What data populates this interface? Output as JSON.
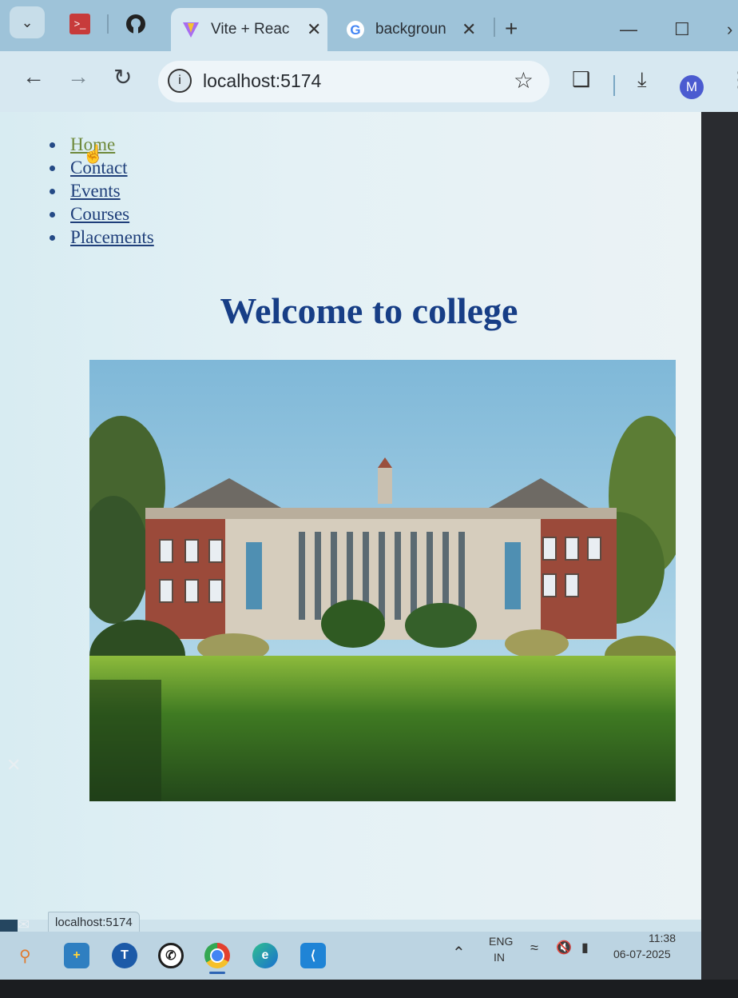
{
  "browser": {
    "tabs": [
      {
        "title": "Vite + Reac",
        "icon": "vite-icon",
        "active": true
      },
      {
        "title": "backgroun",
        "icon": "google-icon",
        "active": false
      }
    ],
    "new_tab": "+",
    "url": "localhost:5174",
    "profile_initial": "M"
  },
  "page": {
    "nav_links": [
      "Home",
      "Contact",
      "Events",
      "Courses",
      "Placements"
    ],
    "heading": "Welcome to college"
  },
  "status_url": "localhost:5174",
  "taskbar": {
    "language": "ENG",
    "region": "IN",
    "time": "11:38",
    "date": "06-07-2025"
  },
  "colors": {
    "heading": "#173e86",
    "link": "#1f3f7a",
    "visited_link": "#6f8a3c",
    "tab_strip": "#9ec3d9"
  }
}
